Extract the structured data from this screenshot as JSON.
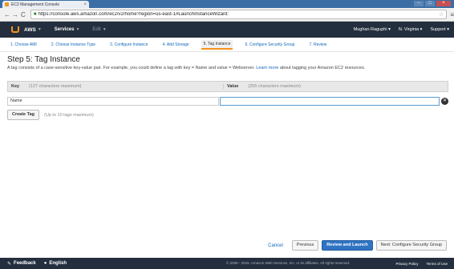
{
  "browser": {
    "tab_title": "EC2 Management Console",
    "tab_close": "×",
    "win_min": "–",
    "win_max": "□",
    "win_close": "×",
    "back": "←",
    "forward": "→",
    "reload": "C",
    "url": "https://console.aws.amazon.com/ec2/v2/home?region=us-east-1#LaunchInstanceWizard:",
    "star": "☆",
    "menu": "≡"
  },
  "topnav": {
    "brand": "AWS",
    "services": "Services",
    "edit": "Edit",
    "user": "Mughan Raguphi",
    "region": "N. Virginia",
    "support": "Support"
  },
  "steps": [
    {
      "label": "1. Choose AMI"
    },
    {
      "label": "2. Choose Instance Type"
    },
    {
      "label": "3. Configure Instance"
    },
    {
      "label": "4. Add Storage"
    },
    {
      "label": "5. Tag Instance"
    },
    {
      "label": "6. Configure Security Group"
    },
    {
      "label": "7. Review"
    }
  ],
  "page": {
    "title": "Step 5: Tag Instance",
    "desc_before": "A tag consists of a case-sensitive key-value pair. For example, you could define a tag with key = Name and value = Webserver. ",
    "desc_link": "Learn more",
    "desc_after": " about tagging your Amazon EC2 resources."
  },
  "table": {
    "key_header": "Key",
    "key_hint": "(127 characters maximum)",
    "value_header": "Value",
    "value_hint": "(255 characters maximum)",
    "rows": [
      {
        "key": "Name",
        "value": ""
      }
    ],
    "delete_glyph": "✕"
  },
  "create": {
    "button": "Create Tag",
    "hint": "(Up to 10 tags maximum)"
  },
  "actions": {
    "cancel": "Cancel",
    "previous": "Previous",
    "review": "Review and Launch",
    "next": "Next: Configure Security Group"
  },
  "footer": {
    "feedback": "Feedback",
    "language": "English",
    "copyright": "© 2008 - 2015, Amazon Web Services, Inc. or its affiliates. All rights reserved.",
    "privacy": "Privacy Policy",
    "terms": "Terms of Use"
  },
  "colors": {
    "aws_orange": "#f7931e",
    "nav_dark": "#232f3e",
    "primary_blue": "#2f73c3",
    "link_blue": "#1166bb"
  }
}
